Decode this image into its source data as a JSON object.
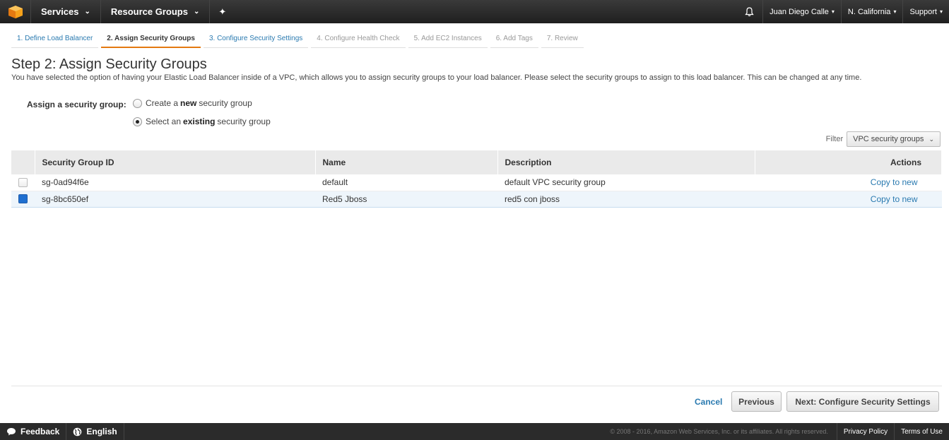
{
  "topnav": {
    "services": "Services",
    "resource_groups": "Resource Groups",
    "chev": "⌄",
    "pin": "✦",
    "user": "Juan Diego Calle",
    "region": "N. California",
    "support": "Support",
    "caret": "▾"
  },
  "wizard": {
    "tabs": [
      "1. Define Load Balancer",
      "2. Assign Security Groups",
      "3. Configure Security Settings",
      "4. Configure Health Check",
      "5. Add EC2 Instances",
      "6. Add Tags",
      "7. Review"
    ]
  },
  "page": {
    "title": "Step 2: Assign Security Groups",
    "description": "You have selected the option of having your Elastic Load Balancer inside of a VPC, which allows you to assign security groups to your load balancer. Please select the security groups to assign to this load balancer. This can be changed at any time."
  },
  "assign": {
    "label": "Assign a security group:",
    "option_new": {
      "pre": "Create a",
      "bold": "new",
      "post": "security group"
    },
    "option_existing": {
      "pre": "Select an",
      "bold": "existing",
      "post": "security group"
    },
    "selected": "existing"
  },
  "filter": {
    "label": "Filter",
    "value": "VPC security groups",
    "chev": "⌄"
  },
  "table": {
    "headers": [
      "Security Group ID",
      "Name",
      "Description",
      "Actions"
    ],
    "rows": [
      {
        "id": "sg-0ad94f6e",
        "name": "default",
        "description": "default VPC security group",
        "action": "Copy to new",
        "checked": false
      },
      {
        "id": "sg-8bc650ef",
        "name": "Red5 Jboss",
        "description": "red5 con jboss",
        "action": "Copy to new",
        "checked": true
      }
    ]
  },
  "buttons": {
    "cancel": "Cancel",
    "previous": "Previous",
    "next": "Next: Configure Security Settings"
  },
  "footer": {
    "feedback": "Feedback",
    "language": "English",
    "copyright": "© 2008 - 2016, Amazon Web Services, Inc. or its affiliates. All rights reserved.",
    "privacy": "Privacy Policy",
    "terms": "Terms of Use"
  },
  "colors": {
    "accent": "#e47911",
    "link": "#2a7ab0",
    "checked": "#1f6fd0"
  }
}
